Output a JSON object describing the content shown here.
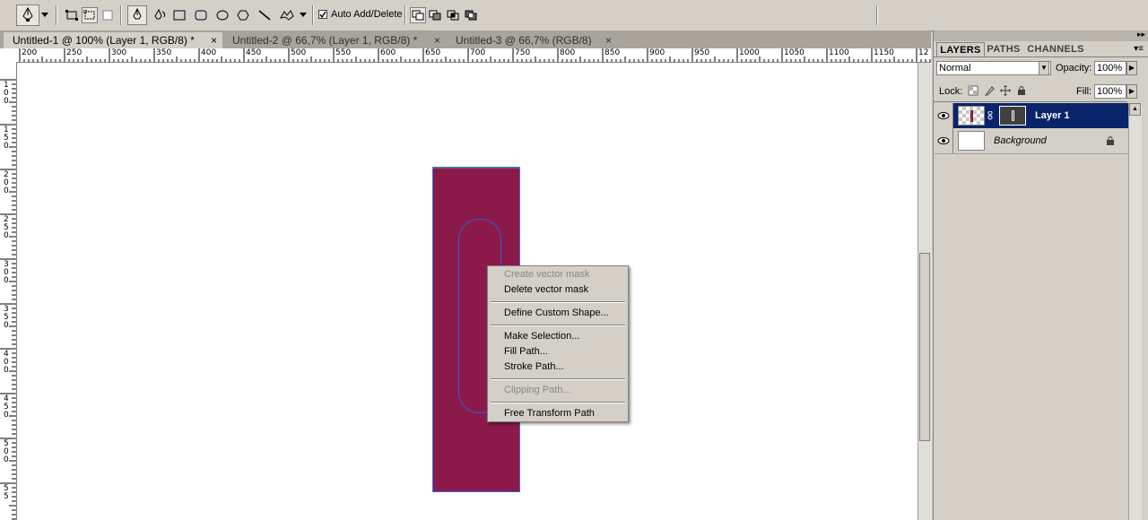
{
  "options_bar": {
    "auto_add_delete_label": "Auto Add/Delete",
    "auto_add_delete_checked": true
  },
  "tabs": [
    {
      "label": "Untitled-1 @ 100% (Layer 1, RGB/8) *",
      "close": "×",
      "active": true
    },
    {
      "label": "Untitled-2 @ 66,7% (Layer 1, RGB/8) *",
      "close": "×",
      "active": false
    },
    {
      "label": "Untitled-3 @ 66,7% (RGB/8)",
      "close": "×",
      "active": false
    }
  ],
  "ruler": {
    "h_labels": [
      "200",
      "250",
      "300",
      "350",
      "400",
      "450",
      "500",
      "550",
      "600",
      "650",
      "700",
      "750",
      "800",
      "850",
      "900",
      "950",
      "1000",
      "1050",
      "1100",
      "1150",
      "12"
    ],
    "v_labels": [
      "100",
      "150",
      "200",
      "250",
      "300",
      "350",
      "400",
      "450",
      "500",
      "55"
    ]
  },
  "canvas": {
    "shape_color": "#8b1a4a",
    "path_color": "#2f5fd0"
  },
  "context_menu": {
    "items": [
      {
        "label": "Create vector mask",
        "enabled": false
      },
      {
        "label": "Delete vector mask",
        "enabled": true
      },
      {
        "label": "Define Custom Shape...",
        "enabled": true
      },
      {
        "label": "Make Selection...",
        "enabled": true
      },
      {
        "label": "Fill Path...",
        "enabled": true
      },
      {
        "label": "Stroke Path...",
        "enabled": true
      },
      {
        "label": "Clipping Path...",
        "enabled": false
      },
      {
        "label": "Free Transform Path",
        "enabled": true
      }
    ]
  },
  "layers_panel": {
    "tabs": [
      "LAYERS",
      "PATHS",
      "CHANNELS"
    ],
    "blend_mode": "Normal",
    "opacity_label": "Opacity:",
    "opacity_value": "100%",
    "lock_label": "Lock:",
    "fill_label": "Fill:",
    "fill_value": "100%",
    "layers": [
      {
        "name": "Layer 1",
        "selected": true,
        "has_mask": true
      },
      {
        "name": "Background",
        "selected": false,
        "locked": true
      }
    ]
  }
}
